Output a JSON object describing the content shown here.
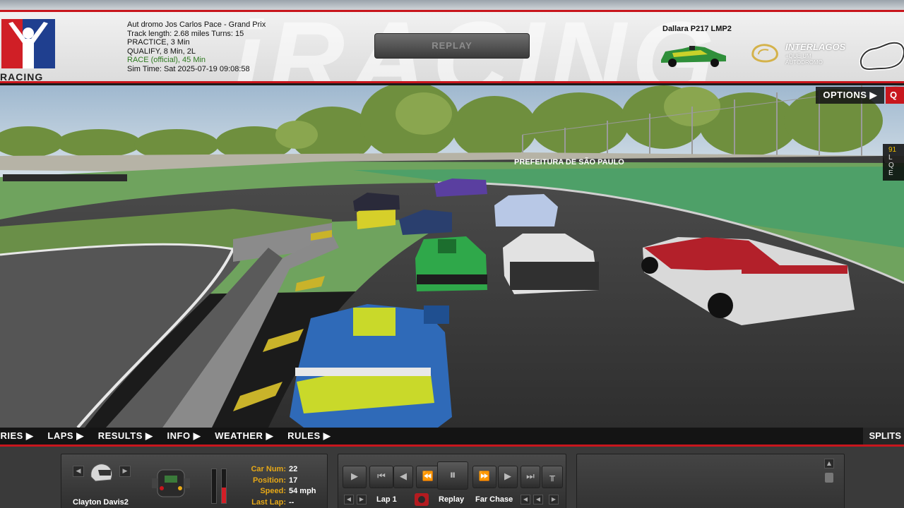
{
  "app": {
    "brand_text": "RACING",
    "watermark": "iRACING"
  },
  "header": {
    "track_name": "Aut dromo Jos  Carlos Pace - Grand Prix",
    "track_length": "Track length: 2.68 miles Turns: 15",
    "practice": "PRACTICE, 3 Min",
    "qualify": "QUALIFY, 8 Min, 2L",
    "race": "RACE (official), 45 Min",
    "sim_time": "Sim Time: Sat 2025-07-19 09:08:58",
    "replay_button": "REPLAY",
    "car_name": "Dallara P217 LMP2",
    "track_logo_title": "INTERLAGOS",
    "track_logo_sub": "+QUE UM AUTÓDROMO"
  },
  "scene": {
    "options_label": "OPTIONS",
    "options_q": "Q",
    "banner_text": "PREFEITURA DE SÃO PAULO",
    "mini": {
      "number": "91",
      "letters": [
        "L",
        "Q",
        "E"
      ]
    }
  },
  "tabs": [
    "TRIES",
    "LAPS",
    "RESULTS",
    "INFO",
    "WEATHER",
    "RULES"
  ],
  "splits_label": "SPLITS",
  "driver": {
    "name": "Clayton Davis2",
    "car_num_label": "Car Num:",
    "car_num": "22",
    "position_label": "Position:",
    "position": "17",
    "speed_label": "Speed:",
    "speed": "54 mph",
    "last_lap_label": "Last Lap:",
    "last_lap": "--",
    "gauge_left_level": 0,
    "gauge_right_level": 0.45
  },
  "transport": {
    "lap_label": "Lap 1",
    "mode_label": "Replay",
    "camera_label": "Far Chase"
  },
  "colors": {
    "accent_red": "#c8161d",
    "label_orange": "#e6a817",
    "race_green": "#2d7a1f"
  },
  "icons": [
    "helmet-icon",
    "steering-wheel-icon",
    "play-icon",
    "pause-icon",
    "rewind-icon",
    "fast-forward-icon",
    "record-icon",
    "camera-select-icon"
  ]
}
